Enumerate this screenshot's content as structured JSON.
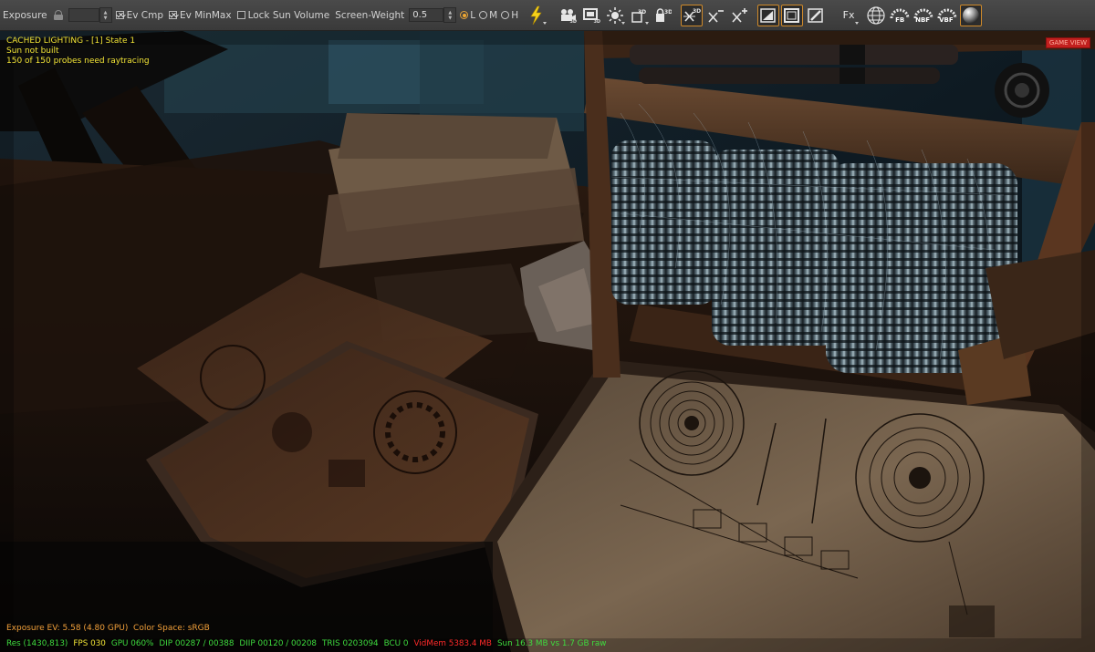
{
  "toolbar": {
    "exposure_label": "Exposure",
    "exposure_value": "",
    "ev_cmp_label": "Ev Cmp",
    "ev_cmp_checked": true,
    "ev_minmax_label": "Ev MinMax",
    "ev_minmax_checked": true,
    "lock_sun_label": "Lock Sun Volume",
    "lock_sun_checked": false,
    "screen_weight_label": "Screen-Weight",
    "screen_weight_value": "0.5",
    "quality_options": [
      "L",
      "M",
      "H"
    ],
    "quality_selected": "L",
    "fx_label": "Fx",
    "fb_label": "FB",
    "nbf_label": "NBF",
    "vbf_label": "VBF",
    "icon_names": [
      "lightning-icon",
      "camera-3d-icon",
      "screen-3d-icon",
      "sun-3d-icon",
      "box-3d-icon",
      "lock-3d-icon",
      "cross-3d-icon",
      "cross-minus-icon",
      "cross-plus-icon",
      "snapshot-icon",
      "frame-icon",
      "edit-icon",
      "fx-icon",
      "grid-sphere-icon",
      "fb-icon",
      "nbf-icon",
      "vbf-icon",
      "material-sphere-icon"
    ]
  },
  "overlay": {
    "lighting_title": "CACHED LIGHTING - [1] State 1",
    "sun_status": "Sun not built",
    "probe_status": "150 of 150 probes need raytracing",
    "game_view_badge": "GAME VIEW",
    "exposure_info": "Exposure EV: 5.58 (4.80 GPU)  Color Space: sRGB"
  },
  "stats": {
    "res": "Res (1430,813)",
    "fps": "FPS 030",
    "gpu": "GPU 060%",
    "dip": "DIP 00287 / 00388",
    "diip": "DIIP 00120 / 00208",
    "tris": "TRIS 0203094",
    "bcu": "BCU 0",
    "vidmem": "VidMem 5383.4 MB",
    "sun": "Sun 16.3 MB vs 1.7 GB raw"
  },
  "colors": {
    "overlay_yellow": "#f2e436",
    "overlay_orange": "#f2a03a",
    "stats_green": "#3fdc3f",
    "stats_red": "#ff2a2a",
    "active_border": "#d08a2a",
    "game_view_badge": "#c2201e"
  }
}
